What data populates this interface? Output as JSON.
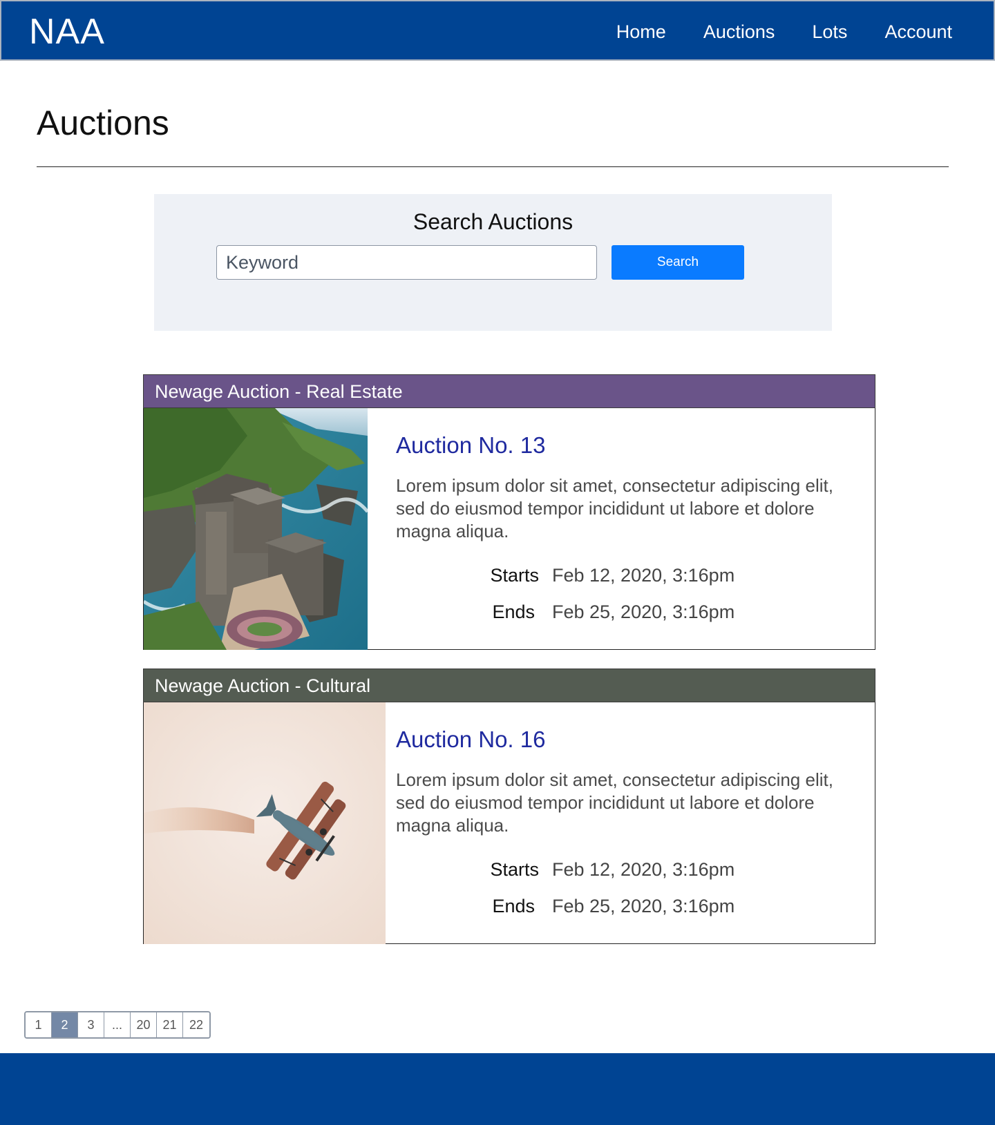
{
  "header": {
    "brand": "NAA",
    "nav": [
      "Home",
      "Auctions",
      "Lots",
      "Account"
    ]
  },
  "page": {
    "title": "Auctions"
  },
  "search": {
    "heading": "Search Auctions",
    "placeholder": "Keyword",
    "button_label": "Search"
  },
  "auctions": [
    {
      "category": "Newage Auction - Real Estate",
      "header_color": "#6a5489",
      "title": "Auction No. 13",
      "description": "Lorem ipsum dolor sit amet, consectetur adipiscing elit, sed do eiusmod tempor incididunt ut labore et dolore magna aliqua.",
      "starts_label": "Starts",
      "starts": "Feb 12, 2020, 3:16pm",
      "ends_label": "Ends",
      "ends": "Feb 25, 2020, 3:16pm"
    },
    {
      "category": "Newage Auction - Cultural",
      "header_color": "#545c52",
      "title": "Auction No. 16",
      "description": "Lorem ipsum dolor sit amet, consectetur adipiscing elit, sed do eiusmod tempor incididunt ut labore et dolore magna aliqua.",
      "starts_label": "Starts",
      "starts": "Feb 12, 2020, 3:16pm",
      "ends_label": "Ends",
      "ends": "Feb 25, 2020, 3:16pm"
    }
  ],
  "pagination": {
    "pages": [
      "1",
      "2",
      "3",
      "...",
      "20",
      "21",
      "22"
    ],
    "current": "2"
  },
  "colors": {
    "nav_bg": "#004493",
    "search_button": "#0a7bff",
    "link": "#1f2a9f",
    "active_page": "#7488a6"
  }
}
